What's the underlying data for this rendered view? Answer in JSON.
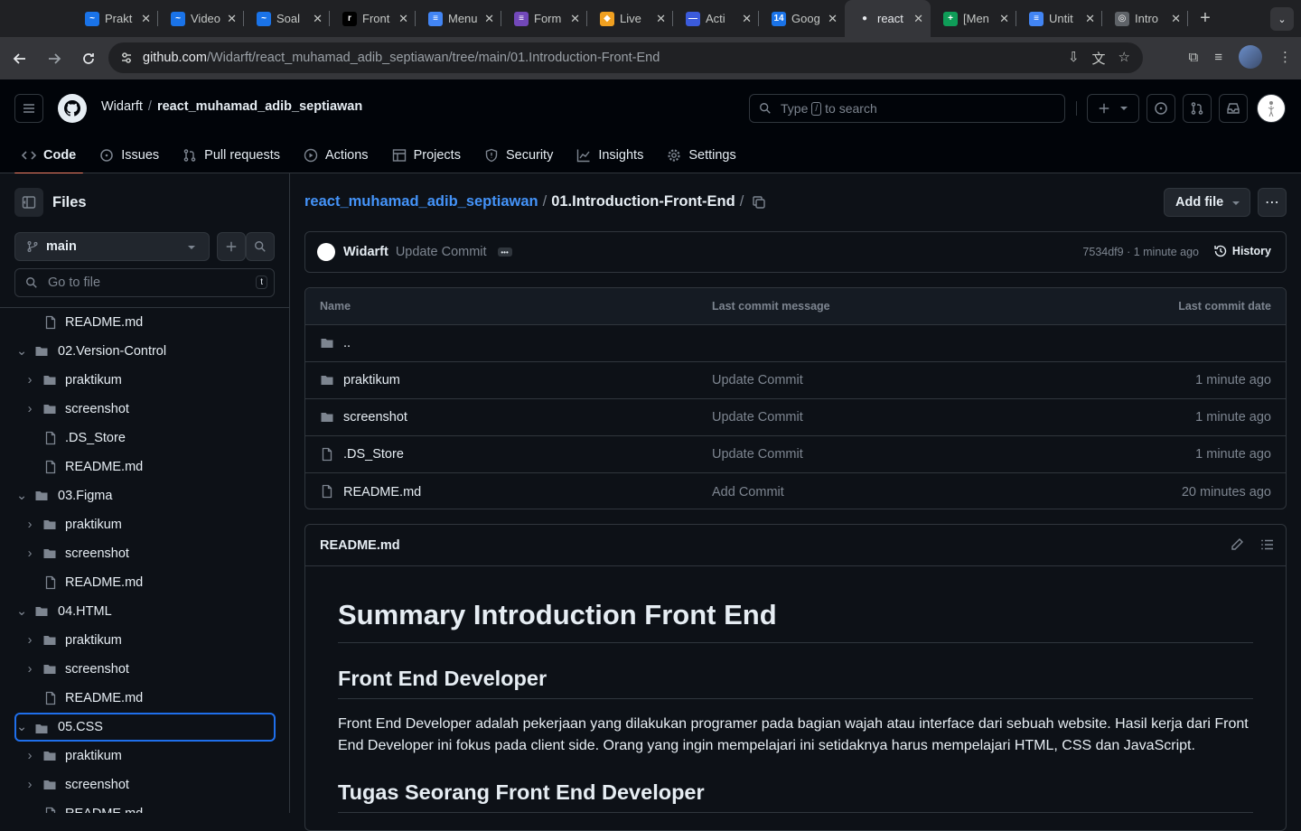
{
  "browser": {
    "tabs": [
      {
        "title": "Prakt",
        "color": "#1a73e8",
        "glyph": "~"
      },
      {
        "title": "Video",
        "color": "#1a73e8",
        "glyph": "~"
      },
      {
        "title": "Soal",
        "color": "#1a73e8",
        "glyph": "~"
      },
      {
        "title": "Front",
        "color": "#000000",
        "glyph": "r"
      },
      {
        "title": "Menu",
        "color": "#4285f4",
        "glyph": "≡"
      },
      {
        "title": "Form",
        "color": "#7248b9",
        "glyph": "≡"
      },
      {
        "title": "Live",
        "color": "#f0a020",
        "glyph": "◆"
      },
      {
        "title": "Acti",
        "color": "#3b5bdb",
        "glyph": "—"
      },
      {
        "title": "Goog",
        "color": "#1a73e8",
        "glyph": "14"
      },
      {
        "title": "react",
        "color": "#ffffff",
        "glyph": "●"
      },
      {
        "title": "[Men",
        "color": "#0f9d58",
        "glyph": "+"
      },
      {
        "title": "Untit",
        "color": "#4285f4",
        "glyph": "≡"
      },
      {
        "title": "Intro",
        "color": "#5f6368",
        "glyph": "◎"
      }
    ],
    "url_host": "github.com",
    "url_path": "/Widarft/react_muhamad_adib_septiawan/tree/main/01.Introduction-Front-End"
  },
  "header": {
    "owner": "Widarft",
    "repo": "react_muhamad_adib_septiawan",
    "search_placeholder_pre": "Type",
    "search_key": "/",
    "search_placeholder_post": "to search"
  },
  "reponav": {
    "code": "Code",
    "issues": "Issues",
    "pulls": "Pull requests",
    "actions": "Actions",
    "projects": "Projects",
    "security": "Security",
    "insights": "Insights",
    "settings": "Settings"
  },
  "sidebar": {
    "title": "Files",
    "branch": "main",
    "gofile_placeholder": "Go to file",
    "gofile_key": "t",
    "tree": [
      {
        "label": "README.md",
        "type": "file",
        "level": 1
      },
      {
        "label": "02.Version-Control",
        "type": "folder-open",
        "level": 0
      },
      {
        "label": "praktikum",
        "type": "folder",
        "level": 1
      },
      {
        "label": "screenshot",
        "type": "folder",
        "level": 1
      },
      {
        "label": ".DS_Store",
        "type": "file",
        "level": 1
      },
      {
        "label": "README.md",
        "type": "file",
        "level": 1
      },
      {
        "label": "03.Figma",
        "type": "folder-open",
        "level": 0
      },
      {
        "label": "praktikum",
        "type": "folder",
        "level": 1
      },
      {
        "label": "screenshot",
        "type": "folder",
        "level": 1
      },
      {
        "label": "README.md",
        "type": "file",
        "level": 1
      },
      {
        "label": "04.HTML",
        "type": "folder-open",
        "level": 0
      },
      {
        "label": "praktikum",
        "type": "folder",
        "level": 1
      },
      {
        "label": "screenshot",
        "type": "folder",
        "level": 1
      },
      {
        "label": "README.md",
        "type": "file",
        "level": 1
      },
      {
        "label": "05.CSS",
        "type": "folder-open",
        "level": 0,
        "selected": true
      },
      {
        "label": "praktikum",
        "type": "folder",
        "level": 1
      },
      {
        "label": "screenshot",
        "type": "folder",
        "level": 1
      },
      {
        "label": "README.md",
        "type": "file",
        "level": 1
      }
    ]
  },
  "main": {
    "path_repo": "react_muhamad_adib_septiawan",
    "path_sep": "/",
    "path_dir": "01.Introduction-Front-End",
    "add_file": "Add file",
    "commit": {
      "author": "Widarft",
      "message": "Update Commit",
      "meta": "7534df9 · 1 minute ago",
      "history": "History"
    },
    "table": {
      "headers": [
        "Name",
        "Last commit message",
        "Last commit date"
      ],
      "parent": "..",
      "rows": [
        {
          "name": "praktikum",
          "type": "folder",
          "message": "Update Commit",
          "date": "1 minute ago"
        },
        {
          "name": "screenshot",
          "type": "folder",
          "message": "Update Commit",
          "date": "1 minute ago"
        },
        {
          "name": ".DS_Store",
          "type": "file",
          "message": "Update Commit",
          "date": "1 minute ago"
        },
        {
          "name": "README.md",
          "type": "file",
          "message": "Add Commit",
          "date": "20 minutes ago"
        }
      ]
    },
    "readme": {
      "filename": "README.md",
      "h1": "Summary Introduction Front End",
      "h2a": "Front End Developer",
      "p1": "Front End Developer adalah pekerjaan yang dilakukan programer pada bagian wajah atau interface dari sebuah website. Hasil kerja dari Front End Developer ini fokus pada client side. Orang yang ingin mempelajari ini setidaknya harus mempelajari HTML, CSS dan JavaScript.",
      "h2b": "Tugas Seorang Front End Developer"
    }
  },
  "colors": {
    "accent_link": "#4493f8",
    "nav_underline": "#f78166",
    "selection_border": "#1f6feb"
  }
}
